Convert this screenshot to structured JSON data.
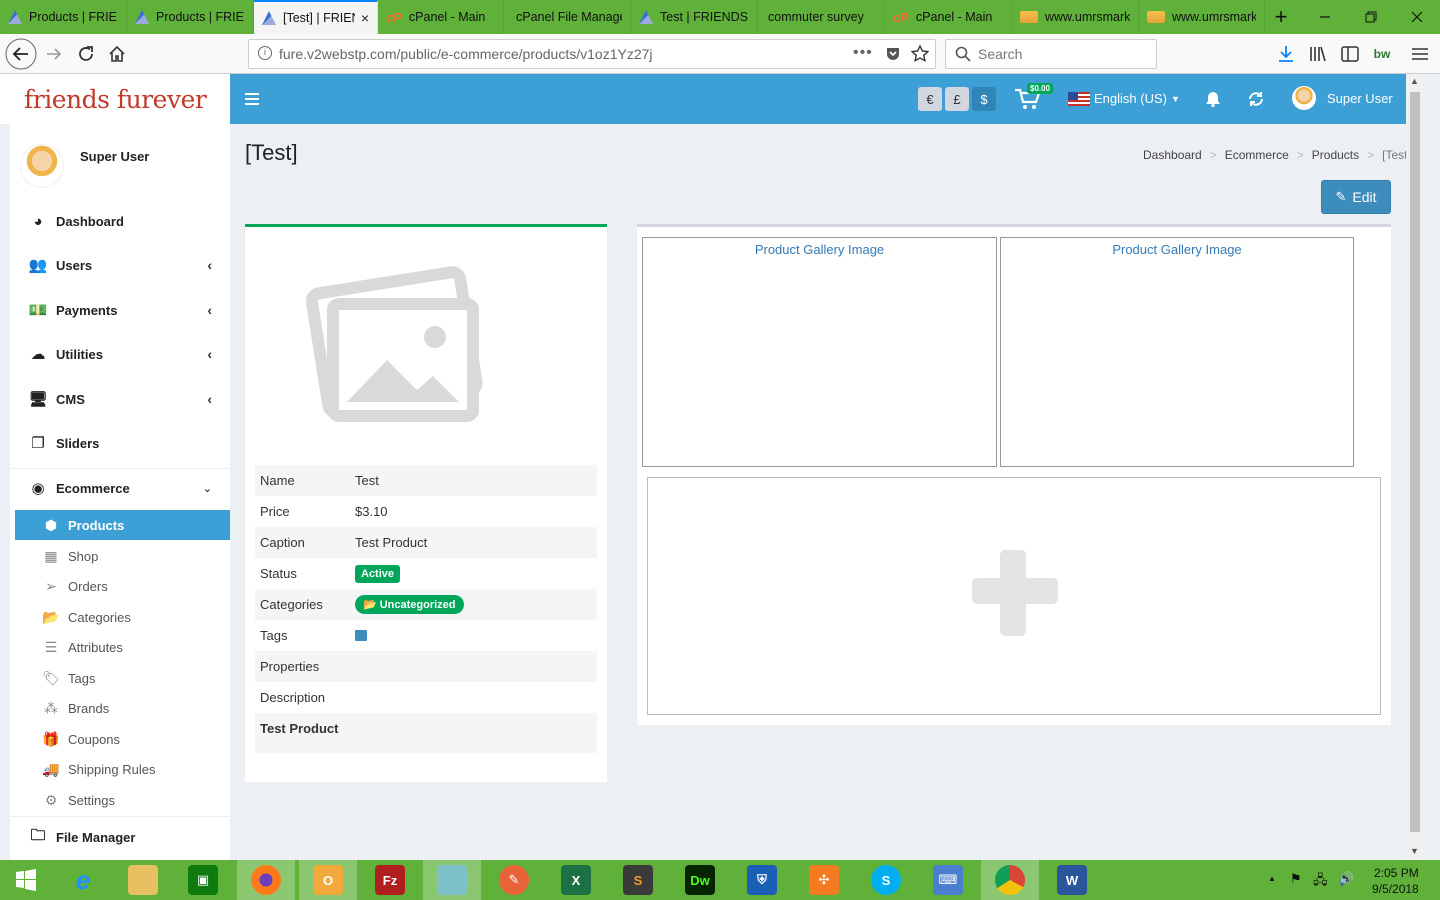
{
  "browser": {
    "tabs": [
      {
        "title": "Products | FRIEN",
        "icon": "firefox-tab-icon"
      },
      {
        "title": "Products | FRIEN",
        "icon": "firefox-tab-icon"
      },
      {
        "title": "[Test] | FRIEN",
        "icon": "firefox-tab-icon",
        "active": true
      },
      {
        "title": "cPanel - Main",
        "icon": "cpanel-icon"
      },
      {
        "title": "cPanel File Manager",
        "icon": "none"
      },
      {
        "title": "Test | FRIENDSF",
        "icon": "firefox-tab-icon"
      },
      {
        "title": "commuter survey",
        "icon": "none"
      },
      {
        "title": "cPanel - Main",
        "icon": "cpanel-icon"
      },
      {
        "title": "www.umrsmark",
        "icon": "phpmyadmin-icon"
      },
      {
        "title": "www.umrsmark",
        "icon": "phpmyadmin-icon"
      }
    ],
    "url": "fure.v2webstp.com/public/e-commerce/products/v1oz1Yz27j",
    "search_placeholder": "Search",
    "new_tab": "+",
    "close_tab": "×"
  },
  "app": {
    "logo_text": "friends furever",
    "currencies": [
      "€",
      "£",
      "$"
    ],
    "cart_amount": "$0.00",
    "language": "English (US)",
    "user_name": "Super User"
  },
  "sidebar": {
    "user_name": "Super User",
    "items": [
      {
        "label": "Dashboard",
        "icon": "dashboard-icon",
        "chevron": false
      },
      {
        "label": "Users",
        "icon": "users-icon",
        "chevron": true
      },
      {
        "label": "Payments",
        "icon": "payments-icon",
        "chevron": true
      },
      {
        "label": "Utilities",
        "icon": "cloud-icon",
        "chevron": true
      },
      {
        "label": "CMS",
        "icon": "monitor-icon",
        "chevron": true
      },
      {
        "label": "Sliders",
        "icon": "sliders-icon",
        "chevron": false
      }
    ],
    "ecommerce": {
      "label": "Ecommerce",
      "children": [
        "Products",
        "Shop",
        "Orders",
        "Categories",
        "Attributes",
        "Tags",
        "Brands",
        "Coupons",
        "Shipping Rules",
        "Settings"
      ]
    },
    "file_manager": "File Manager"
  },
  "page": {
    "title": "[Test]",
    "breadcrumb": [
      "Dashboard",
      "Ecommerce",
      "Products",
      "[Test]"
    ],
    "edit_label": "Edit"
  },
  "product": {
    "fields": [
      {
        "key": "Name",
        "value": "Test"
      },
      {
        "key": "Price",
        "value": "$3.10"
      },
      {
        "key": "Caption",
        "value": "Test Product"
      },
      {
        "key": "Status",
        "value": "Active"
      },
      {
        "key": "Categories",
        "value": "Uncategorized"
      },
      {
        "key": "Tags",
        "value": ""
      },
      {
        "key": "Properties",
        "value": ""
      },
      {
        "key": "Description",
        "value": ""
      }
    ],
    "description_text": "Test Product"
  },
  "gallery": {
    "image_label": "Product Gallery Image"
  },
  "taskbar": {
    "time": "2:05 PM",
    "date": "9/5/2018"
  },
  "colors": {
    "accent": "#3c9fd5",
    "success": "#00a65a",
    "browser_chrome": "#5fb13a"
  }
}
